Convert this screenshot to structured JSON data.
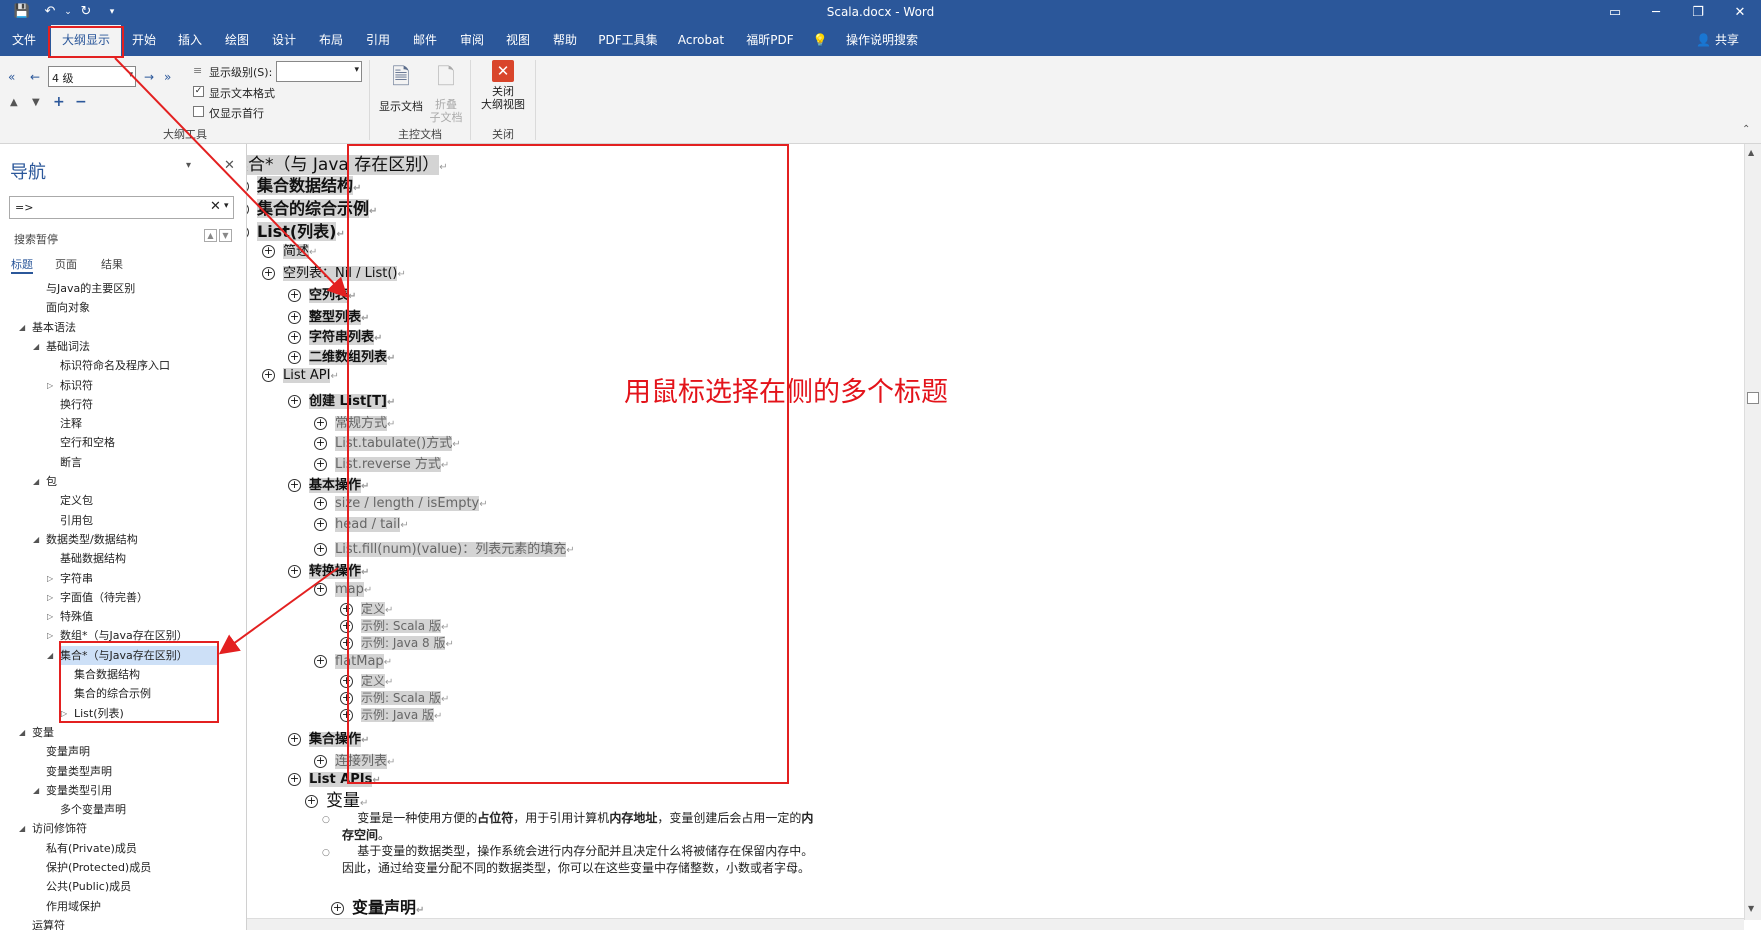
{
  "titlebar": {
    "title": "Scala.docx  -  Word"
  },
  "tabs": [
    "文件",
    "大纲显示",
    "开始",
    "插入",
    "绘图",
    "设计",
    "布局",
    "引用",
    "邮件",
    "审阅",
    "视图",
    "帮助",
    "PDF工具集",
    "Acrobat",
    "福昕PDF",
    "操作说明搜索"
  ],
  "share_label": "共享",
  "ribbon": {
    "level_value": "4 级",
    "show_level_label": "显示级别(S):",
    "show_text_format_label": "显示文本格式",
    "show_first_line_label": "仅显示首行",
    "group_outline_tools": "大纲工具",
    "show_document_label": "显示文档",
    "collapse_subdocs_label": "折叠\n子文档",
    "group_master_doc": "主控文档",
    "close_outline_label": "关闭\n大纲视图",
    "group_close": "关闭"
  },
  "nav": {
    "title": "导航",
    "search_value": "=>",
    "search_pause": "搜索暂停",
    "tabs": [
      "标题",
      "页面",
      "结果"
    ],
    "items": [
      {
        "label": "与Java的主要区别",
        "indent": 3,
        "arrow": ""
      },
      {
        "label": "面向对象",
        "indent": 3,
        "arrow": ""
      },
      {
        "label": "基本语法",
        "indent": 2,
        "arrow": "◢"
      },
      {
        "label": "基础词法",
        "indent": 3,
        "arrow": "◢"
      },
      {
        "label": "标识符命名及程序入口",
        "indent": 4,
        "arrow": ""
      },
      {
        "label": "标识符",
        "indent": 4,
        "arrow": "▷"
      },
      {
        "label": "换行符",
        "indent": 4,
        "arrow": ""
      },
      {
        "label": "注释",
        "indent": 4,
        "arrow": ""
      },
      {
        "label": "空行和空格",
        "indent": 4,
        "arrow": ""
      },
      {
        "label": "断言",
        "indent": 4,
        "arrow": ""
      },
      {
        "label": "包",
        "indent": 3,
        "arrow": "◢"
      },
      {
        "label": "定义包",
        "indent": 4,
        "arrow": ""
      },
      {
        "label": "引用包",
        "indent": 4,
        "arrow": ""
      },
      {
        "label": "数据类型/数据结构",
        "indent": 3,
        "arrow": "◢"
      },
      {
        "label": "基础数据结构",
        "indent": 4,
        "arrow": ""
      },
      {
        "label": "字符串",
        "indent": 4,
        "arrow": "▷"
      },
      {
        "label": "字面值（待完善）",
        "indent": 4,
        "arrow": "▷"
      },
      {
        "label": "特殊值",
        "indent": 4,
        "arrow": "▷"
      },
      {
        "label": "数组*（与Java存在区别）",
        "indent": 4,
        "arrow": "▷"
      },
      {
        "label": "集合*（与Java存在区别）",
        "indent": 4,
        "arrow": "◢",
        "selected": true
      },
      {
        "label": "集合数据结构",
        "indent": 5,
        "arrow": ""
      },
      {
        "label": "集合的综合示例",
        "indent": 5,
        "arrow": ""
      },
      {
        "label": "List(列表)",
        "indent": 5,
        "arrow": "▷"
      },
      {
        "label": "变量",
        "indent": 2,
        "arrow": "◢"
      },
      {
        "label": "变量声明",
        "indent": 3,
        "arrow": ""
      },
      {
        "label": "变量类型声明",
        "indent": 3,
        "arrow": ""
      },
      {
        "label": "变量类型引用",
        "indent": 3,
        "arrow": "◢"
      },
      {
        "label": "多个变量声明",
        "indent": 4,
        "arrow": ""
      },
      {
        "label": "访问修饰符",
        "indent": 2,
        "arrow": "◢"
      },
      {
        "label": "私有(Private)成员",
        "indent": 3,
        "arrow": ""
      },
      {
        "label": "保护(Protected)成员",
        "indent": 3,
        "arrow": ""
      },
      {
        "label": "公共(Public)成员",
        "indent": 3,
        "arrow": ""
      },
      {
        "label": "作用域保护",
        "indent": 3,
        "arrow": ""
      },
      {
        "label": "运算符",
        "indent": 2,
        "arrow": ""
      }
    ]
  },
  "outline": [
    {
      "text": "集合*（与 Java 存在区别）",
      "level": 1,
      "bold": false,
      "size": "big"
    },
    {
      "text": "集合数据结构",
      "level": 2,
      "bold": true,
      "size": "med"
    },
    {
      "text": "集合的综合示例",
      "level": 2,
      "bold": true,
      "size": "med"
    },
    {
      "text": "List(列表)",
      "level": 2,
      "bold": true,
      "size": "med"
    },
    {
      "text": "简述",
      "level": 3,
      "bold": false,
      "size": "sm"
    },
    {
      "text": "空列表：Nil / List()",
      "level": 3,
      "bold": false,
      "size": "sm"
    },
    {
      "text": "空列表",
      "level": 4,
      "bold": true,
      "size": "sm"
    },
    {
      "text": "整型列表",
      "level": 4,
      "bold": true,
      "size": "sm"
    },
    {
      "text": "字符串列表",
      "level": 4,
      "bold": true,
      "size": "sm"
    },
    {
      "text": "二维数组列表",
      "level": 4,
      "bold": true,
      "size": "sm"
    },
    {
      "text": "List API",
      "level": 3,
      "bold": false,
      "size": "sm"
    },
    {
      "text": "创建 List[T]",
      "level": 4,
      "bold": true,
      "size": "sm"
    },
    {
      "text": "常规方式",
      "level": 5,
      "bold": false,
      "size": "sm",
      "gray": true
    },
    {
      "text": "List.tabulate()方式",
      "level": 5,
      "bold": false,
      "size": "sm",
      "gray": true
    },
    {
      "text": "List.reverse 方式",
      "level": 5,
      "bold": false,
      "size": "sm",
      "gray": true
    },
    {
      "text": "基本操作",
      "level": 4,
      "bold": true,
      "size": "sm"
    },
    {
      "text": "size / length / isEmpty",
      "level": 5,
      "bold": false,
      "size": "sm",
      "gray": true
    },
    {
      "text": "head / tail",
      "level": 5,
      "bold": false,
      "size": "sm",
      "gray": true
    },
    {
      "text": "List.fill(num)(value)：列表元素的填充",
      "level": 5,
      "bold": false,
      "size": "sm",
      "gray": true
    },
    {
      "text": "转换操作",
      "level": 4,
      "bold": true,
      "size": "sm"
    },
    {
      "text": "map",
      "level": 5,
      "bold": false,
      "size": "sm",
      "gray": true
    },
    {
      "text": "定义",
      "level": 6,
      "bold": false,
      "size": "xs",
      "gray": true
    },
    {
      "text": "示例: Scala 版",
      "level": 6,
      "bold": false,
      "size": "xs",
      "gray": true
    },
    {
      "text": "示例: Java 8 版",
      "level": 6,
      "bold": false,
      "size": "xs",
      "gray": true
    },
    {
      "text": "flatMap",
      "level": 5,
      "bold": false,
      "size": "sm",
      "gray": true
    },
    {
      "text": "定义",
      "level": 6,
      "bold": false,
      "size": "xs",
      "gray": true
    },
    {
      "text": "示例: Scala 版",
      "level": 6,
      "bold": false,
      "size": "xs",
      "gray": true
    },
    {
      "text": "示例: Java 版",
      "level": 6,
      "bold": false,
      "size": "xs",
      "gray": true
    },
    {
      "text": "集合操作",
      "level": 4,
      "bold": true,
      "size": "sm"
    },
    {
      "text": "连接列表",
      "level": 5,
      "bold": false,
      "size": "sm",
      "gray": true
    },
    {
      "text": "List APIs",
      "level": 4,
      "bold": true,
      "size": "sm"
    }
  ],
  "variable_heading": "变量",
  "para1": {
    "t1": "变量是一种使用方便的",
    "b1": "占位符",
    "t2": "，用于引用计算机",
    "b2": "内存地址",
    "t3": "，变量创建后会占用一定的",
    "b3": "内存空间",
    "t4": "。"
  },
  "para2": "基于变量的数据类型，操作系统会进行内存分配并且决定什么将被储存在保留内存中。因此，通过给变量分配不同的数据类型，你可以在这些变量中存储整数，小数或者字母。",
  "var_decl_heading": "变量声明",
  "annotation": "用鼠标选择在侧的多个标题",
  "colors": {
    "word_blue": "#2b579a",
    "red": "#e32020",
    "selection": "#d4d4d4"
  }
}
